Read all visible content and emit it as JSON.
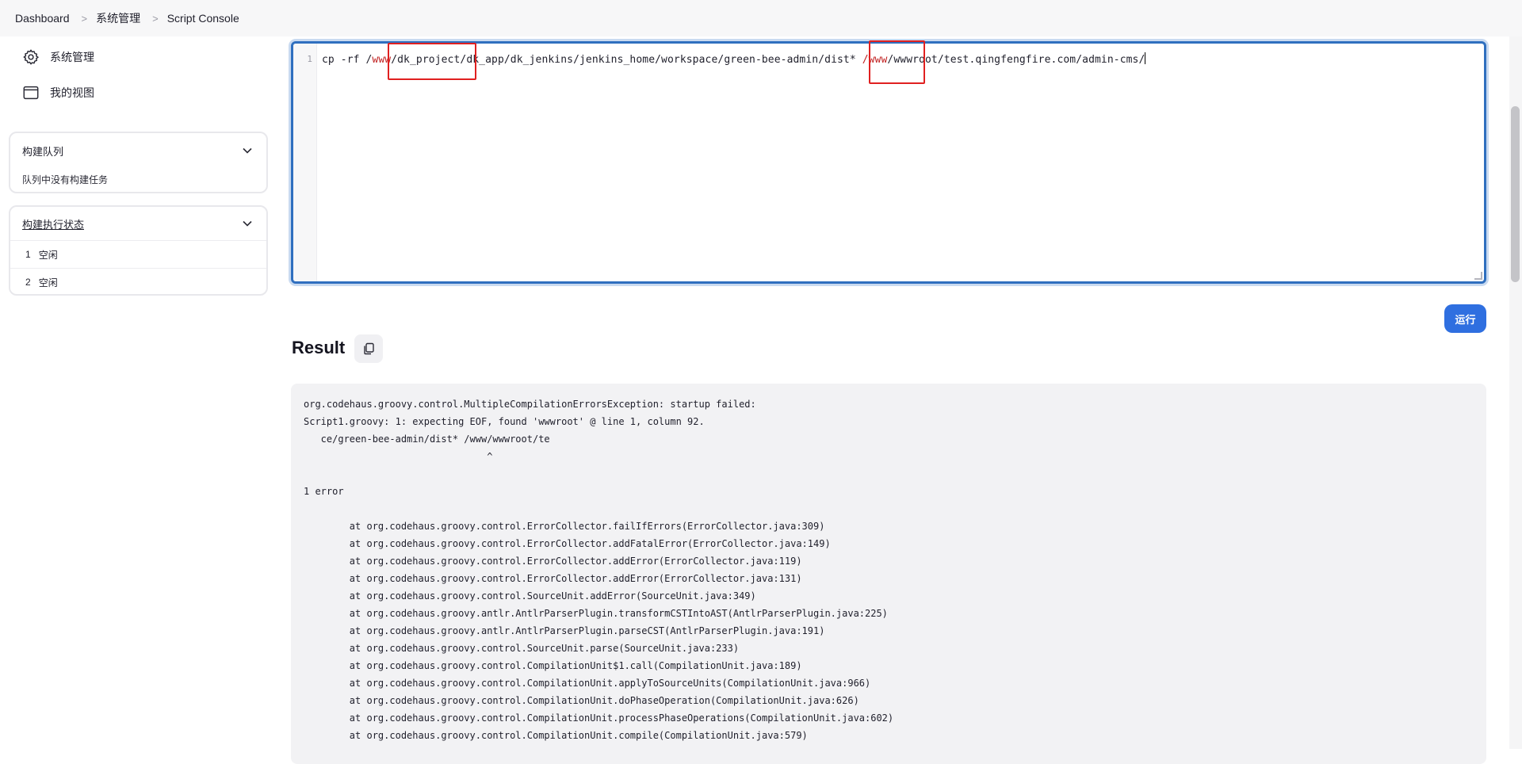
{
  "breadcrumb": {
    "items": [
      "Dashboard",
      "系统管理",
      "Script Console"
    ]
  },
  "sidebar": {
    "links": [
      {
        "label": "系统管理",
        "icon": "gear-icon"
      },
      {
        "label": "我的视图",
        "icon": "window-icon"
      }
    ],
    "build_queue": {
      "title": "构建队列",
      "empty_text": "队列中没有构建任务"
    },
    "executors": {
      "title": "构建执行状态",
      "rows": [
        {
          "num": "1",
          "status": "空闲"
        },
        {
          "num": "2",
          "status": "空闲"
        }
      ]
    }
  },
  "editor": {
    "line_number": "1",
    "segments": [
      {
        "text": "cp -rf /",
        "style": "normal"
      },
      {
        "text": "www",
        "style": "red"
      },
      {
        "text": "/dk_project/dk_app/dk_jenkins/jenkins_home/workspace/green-bee-admin/dist* ",
        "style": "normal"
      },
      {
        "text": "/www",
        "style": "red"
      },
      {
        "text": "/wwwroot/test.qingfengfire.com/admin-cms/",
        "style": "normal"
      }
    ]
  },
  "run_button": {
    "label": "运行"
  },
  "result": {
    "title": "Result",
    "copy_icon": "copy-icon",
    "lines": [
      "org.codehaus.groovy.control.MultipleCompilationErrorsException: startup failed:",
      "Script1.groovy: 1: expecting EOF, found 'wwwroot' @ line 1, column 92.",
      "   ce/green-bee-admin/dist* /www/wwwroot/te",
      "                                ^",
      "",
      "1 error",
      "",
      "        at org.codehaus.groovy.control.ErrorCollector.failIfErrors(ErrorCollector.java:309)",
      "        at org.codehaus.groovy.control.ErrorCollector.addFatalError(ErrorCollector.java:149)",
      "        at org.codehaus.groovy.control.ErrorCollector.addError(ErrorCollector.java:119)",
      "        at org.codehaus.groovy.control.ErrorCollector.addError(ErrorCollector.java:131)",
      "        at org.codehaus.groovy.control.SourceUnit.addError(SourceUnit.java:349)",
      "        at org.codehaus.groovy.antlr.AntlrParserPlugin.transformCSTIntoAST(AntlrParserPlugin.java:225)",
      "        at org.codehaus.groovy.antlr.AntlrParserPlugin.parseCST(AntlrParserPlugin.java:191)",
      "        at org.codehaus.groovy.control.SourceUnit.parse(SourceUnit.java:233)",
      "        at org.codehaus.groovy.control.CompilationUnit$1.call(CompilationUnit.java:189)",
      "        at org.codehaus.groovy.control.CompilationUnit.applyToSourceUnits(CompilationUnit.java:966)",
      "        at org.codehaus.groovy.control.CompilationUnit.doPhaseOperation(CompilationUnit.java:626)",
      "        at org.codehaus.groovy.control.CompilationUnit.processPhaseOperations(CompilationUnit.java:602)",
      "        at org.codehaus.groovy.control.CompilationUnit.compile(CompilationUnit.java:579)"
    ]
  },
  "colors": {
    "accent": "#2f6fe0",
    "highlight": "#e02020",
    "editor_border": "#2f6fbf"
  }
}
